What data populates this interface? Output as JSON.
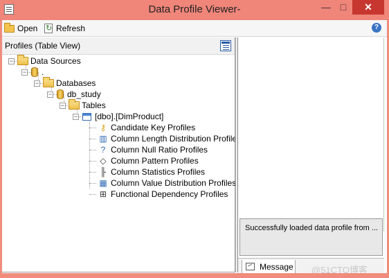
{
  "window": {
    "title": "Data Profile Viewer-",
    "minimize": "—",
    "maximize": "□",
    "close": "✕"
  },
  "toolbar": {
    "open_label": "Open",
    "refresh_label": "Refresh",
    "help": "?"
  },
  "left_pane": {
    "title": "Profiles (Table View)",
    "tree": [
      {
        "label": "Data Sources",
        "expander": "−",
        "icon": "folder-icon"
      },
      {
        "label": ".",
        "expander": "−",
        "icon": "database-icon"
      },
      {
        "label": "Databases",
        "expander": "−",
        "icon": "folder-icon"
      },
      {
        "label": "db_study",
        "expander": "−",
        "icon": "database-icon"
      },
      {
        "label": "Tables",
        "expander": "−",
        "icon": "folder-icon"
      },
      {
        "label": "[dbo].[DimProduct]",
        "expander": "−",
        "icon": "table-icon"
      },
      {
        "label": "Candidate Key Profiles",
        "icon": "key-icon"
      },
      {
        "label": "Column Length Distribution Profiles",
        "icon": "bar-chart-icon"
      },
      {
        "label": "Column Null Ratio Profiles",
        "icon": "null-ratio-icon"
      },
      {
        "label": "Column Pattern Profiles",
        "icon": "pattern-icon"
      },
      {
        "label": "Column Statistics Profiles",
        "icon": "statistics-icon"
      },
      {
        "label": "Column Value Distribution Profiles",
        "icon": "distribution-icon"
      },
      {
        "label": "Functional Dependency Profiles",
        "icon": "dependency-icon"
      }
    ]
  },
  "right_pane": {
    "message": "Successfully loaded data profile from  ...",
    "tab": "Message",
    "watermark": "@51CTO博客"
  },
  "colors": {
    "titlebar": "#f0857a",
    "close_button": "#c7372f",
    "folder": "#efc04b",
    "accent": "#2a5ca8"
  }
}
